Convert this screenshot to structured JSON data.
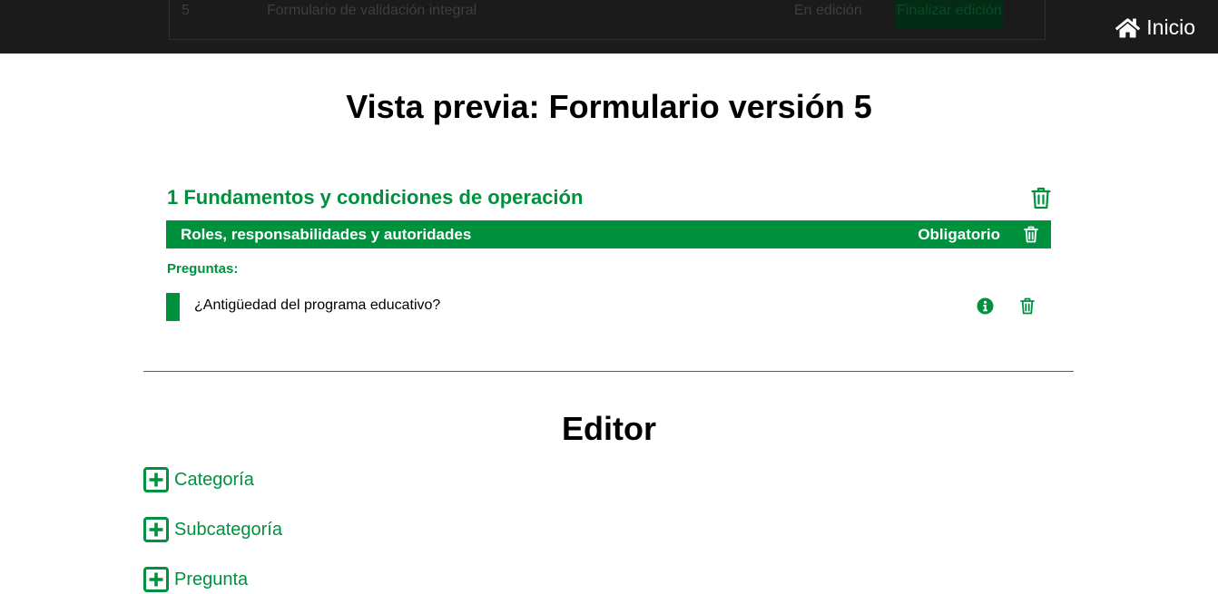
{
  "topbar": {
    "background_row": {
      "number": "5",
      "name": "Formulario de validación integral",
      "status": "En edición",
      "button": "Finalizar edición"
    },
    "home_label": "Inicio",
    "home_icon": "home-icon"
  },
  "preview": {
    "title": "Vista previa: Formulario versión 5",
    "category": {
      "title": "1 Fundamentos y condiciones de operación",
      "subcategory": {
        "name": "Roles, responsabilidades y autoridades",
        "required": "Obligatorio"
      },
      "questions_label": "Preguntas:",
      "questions": [
        {
          "text": "¿Antigüedad del programa educativo?"
        }
      ]
    }
  },
  "editor": {
    "title": "Editor",
    "actions": [
      {
        "label": "Categoría",
        "icon": "plus-square-icon"
      },
      {
        "label": "Subcategoría",
        "icon": "plus-square-icon"
      },
      {
        "label": "Pregunta",
        "icon": "plus-square-icon"
      }
    ]
  },
  "colors": {
    "accent": "#00913f",
    "topbar": "#1b1b1b"
  }
}
